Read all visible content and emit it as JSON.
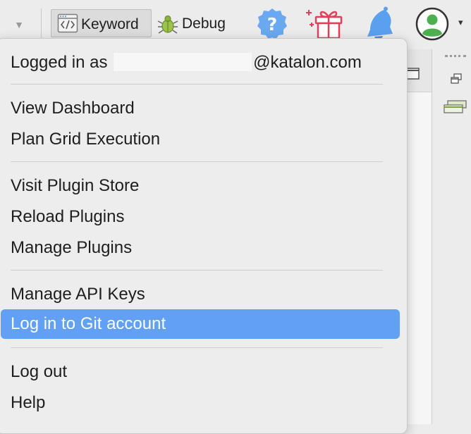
{
  "toolbar": {
    "dropdown_glyph": "▼",
    "keyword_label": "Keyword",
    "debug_label": "Debug",
    "help_glyph": "?",
    "account_caret": "▾"
  },
  "account_menu": {
    "logged_in_prefix": "Logged in as",
    "logged_in_domain": "@katalon.com",
    "groups": [
      [
        "View Dashboard",
        "Plan Grid Execution"
      ],
      [
        "Visit Plugin Store",
        "Reload Plugins",
        "Manage Plugins"
      ],
      [
        "Manage API Keys",
        "Log in to Git account"
      ],
      [
        "Log out",
        "Help"
      ]
    ],
    "selected_item": "Log in to Git account",
    "selection_color": "#62a0f5"
  },
  "icons": {
    "keyword": "code-window-icon",
    "debug": "bug-icon",
    "help": "help-badge-icon",
    "gift": "gift-icon",
    "notifications": "bell-icon",
    "account": "user-avatar-icon"
  }
}
